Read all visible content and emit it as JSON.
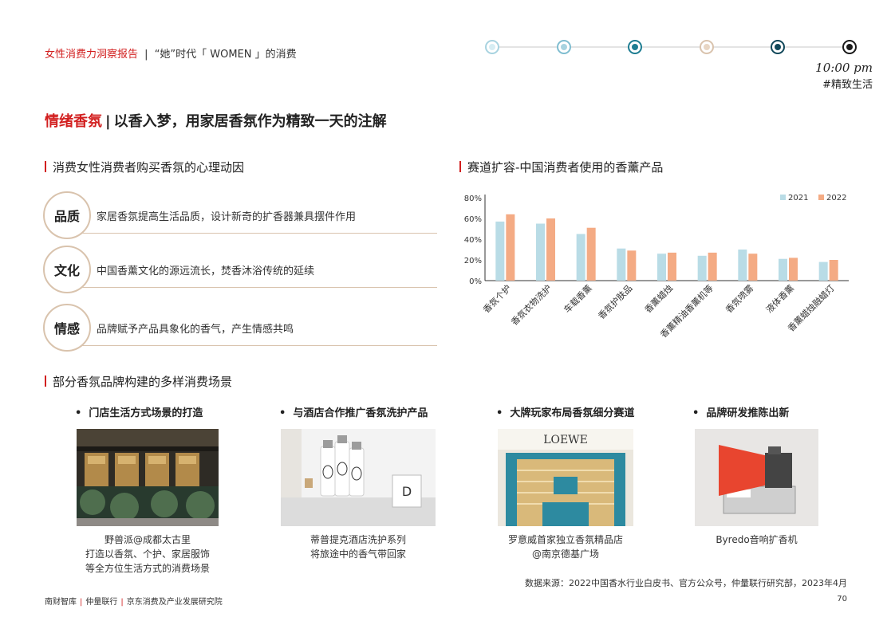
{
  "header": {
    "report_name": "女性消费力洞察报告",
    "separator": "|",
    "subtitle": "“她”时代「 WOMEN 」的消费"
  },
  "timeline": {
    "dots": [
      {
        "ring": "#a8d3e0",
        "fill": "#d6edf3"
      },
      {
        "ring": "#7fbdd0",
        "fill": "#a8d3e0"
      },
      {
        "ring": "#1e7d92",
        "fill": "#1e7d92"
      },
      {
        "ring": "#d9c3ad",
        "fill": "#e8d6c4"
      },
      {
        "ring": "#11485a",
        "fill": "#11485a"
      },
      {
        "ring": "#1a1a1a",
        "fill": "#1a1a1a"
      }
    ],
    "time": "10:00 pm",
    "tag": "#精致生活"
  },
  "title": {
    "keyword": "情绪香氛",
    "bar": "|",
    "text": "以香入梦，用家居香氛作为精致一天的注解"
  },
  "left_section": {
    "title": "消费女性消费者购买香氛的心理动因",
    "motives": [
      {
        "label": "品质",
        "text": "家居香氛提高生活品质，设计新奇的扩香器兼具摆件作用"
      },
      {
        "label": "文化",
        "text": "中国香薰文化的源远流长，焚香沐浴传统的延续"
      },
      {
        "label": "情感",
        "text": "品牌赋予产品具象化的香气，产生情感共鸣"
      }
    ]
  },
  "right_section": {
    "title": "赛道扩容-中国消费者使用的香薰产品"
  },
  "chart_data": {
    "type": "bar",
    "categories": [
      "香氛个护",
      "香氛衣物洗护",
      "车载香薰",
      "香氛护肤品",
      "香薰蜡烛",
      "香薰精油香薰机等",
      "香氛喷雾",
      "液体香薰",
      "香薰蜡烛融蜡灯"
    ],
    "series": [
      {
        "name": "2021",
        "color": "#b9dce6",
        "values": [
          57,
          55,
          45,
          31,
          26,
          24,
          30,
          21,
          18
        ]
      },
      {
        "name": "2022",
        "color": "#f4ab84",
        "values": [
          64,
          60,
          51,
          29,
          27,
          27,
          26,
          22,
          20
        ]
      }
    ],
    "y_ticks": [
      "0%",
      "20%",
      "40%",
      "60%",
      "80%"
    ],
    "ylim": [
      0,
      80
    ],
    "legend_position": "top-right",
    "grid": false
  },
  "scenes_section": {
    "title": "部分香氛品牌构建的多样消费场景",
    "scenes": [
      {
        "title": "门店生活方式场景的打造",
        "caption": [
          "野兽派@成都太古里",
          "打造以香氛、个护、家居服饰",
          "等全方位生活方式的消费场景"
        ]
      },
      {
        "title": "与酒店合作推广香氛洗护产品",
        "caption": [
          "蒂普提克酒店洗护系列",
          "将旅途中的香气带回家"
        ]
      },
      {
        "title": "大牌玩家布局香氛细分赛道",
        "caption": [
          "罗意威首家独立香氛精品店",
          "@南京德基广场"
        ],
        "sign": "LOEWE"
      },
      {
        "title": "品牌研发推陈出新",
        "caption": [
          "Byredo音响扩香机"
        ]
      }
    ]
  },
  "source": "数据来源：2022中国香水行业白皮书、官方公众号，仲量联行研究部，2023年4月",
  "footer": {
    "org1": "南财智库",
    "org2": "仲量联行",
    "org3": "京东消费及产业发展研究院",
    "sep": "|",
    "page": "70"
  }
}
